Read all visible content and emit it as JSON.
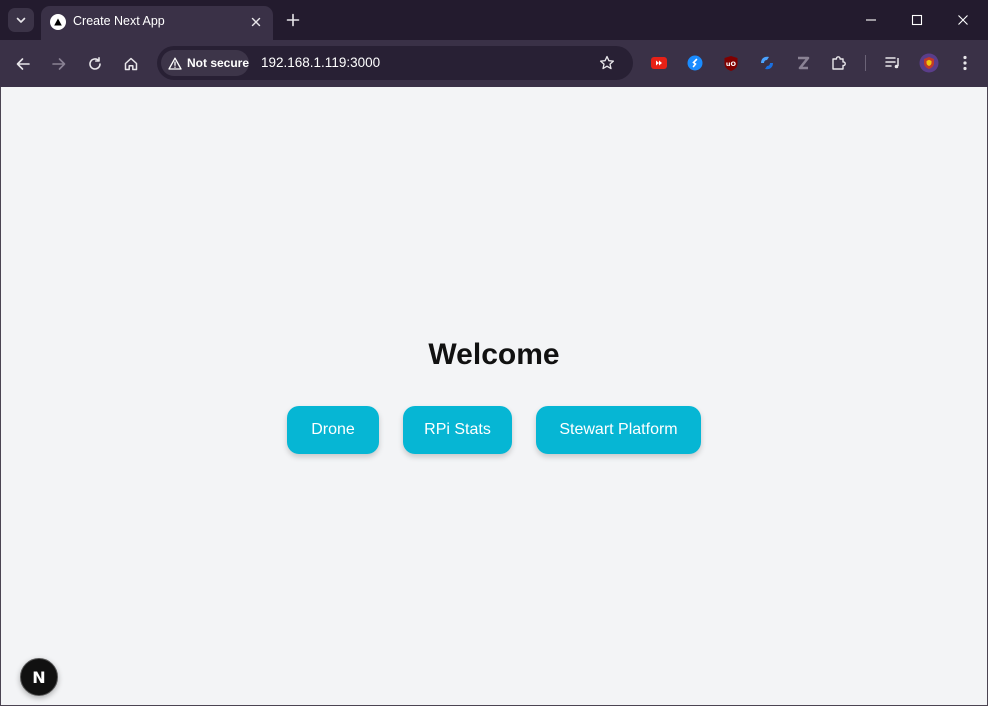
{
  "browser": {
    "tab": {
      "title": "Create Next App",
      "favicon": "nextjs-triangle-icon"
    },
    "address_bar": {
      "security_label": "Not secure",
      "url": "192.168.1.119:3000"
    },
    "extensions": [
      "youtube-red-icon",
      "shazam-icon",
      "ublock-icon",
      "blue-swirl-extension-icon",
      "z-extension-icon",
      "puzzle-extensions-icon"
    ]
  },
  "page": {
    "heading": "Welcome",
    "buttons": [
      {
        "label": "Drone"
      },
      {
        "label": "RPi Stats"
      },
      {
        "label": "Stewart Platform"
      }
    ],
    "dev_badge": "N"
  },
  "colors": {
    "titlebar": "#231b2e",
    "toolbar": "#3a3147",
    "accent_button": "#06b6d4",
    "page_background": "#f3f4f6"
  }
}
